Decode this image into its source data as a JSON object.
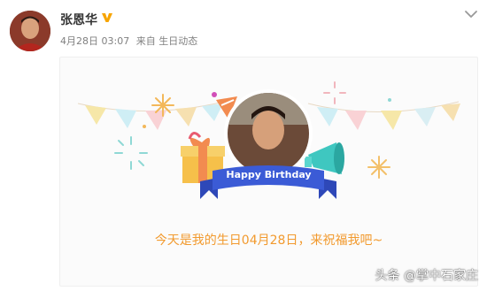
{
  "post": {
    "username": "张恩华",
    "date": "4月28日 03:07",
    "source": "来自 生日动态",
    "verified_icon": "verified-v-icon",
    "menu_icon": "chevron-down-icon"
  },
  "card": {
    "ribbon_text": "Happy Birthday",
    "greeting": "今天是我的生日04月28日，来祝福我吧~"
  },
  "watermark": "头条 @掌中石家庄",
  "colors": {
    "accent": "#f29a2e",
    "ribbon": "#3b5bd6",
    "verified": "#f7a400"
  }
}
